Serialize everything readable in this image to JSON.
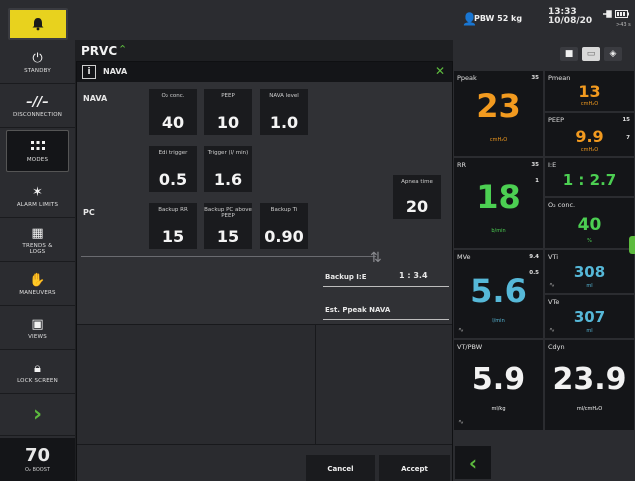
{
  "topbar": {
    "pbw": "PBW 52 kg",
    "time": "13:33",
    "date": "10/08/20",
    "battery_sub": ">43 s",
    "icons": [
      "bell-icon",
      "person-icon",
      "plug-icon",
      "battery-icon"
    ]
  },
  "sidebar": {
    "items": [
      {
        "label": "STANDBY",
        "icon": "power-icon"
      },
      {
        "label": "DISCONNECTION",
        "icon": "disconnect-icon"
      },
      {
        "label": "MODES",
        "icon": "grid-icon"
      },
      {
        "label": "ALARM LIMITS",
        "icon": "alarm-limits-icon"
      },
      {
        "label": "TRENDS & LOGS",
        "icon": "trends-icon"
      },
      {
        "label": "MANEUVERS",
        "icon": "maneuvers-icon"
      },
      {
        "label": "VIEWS",
        "icon": "views-icon"
      },
      {
        "label": "LOCK SCREEN",
        "icon": "lock-icon"
      }
    ],
    "o2_boost_value": "70",
    "o2_boost_label": "O₂ BOOST"
  },
  "mode": {
    "title": "PRVC"
  },
  "dialog": {
    "title": "NAVA",
    "nava_section": "NAVA",
    "pc_section": "PC",
    "params": {
      "o2": {
        "label": "O₂ conc.",
        "value": "40"
      },
      "peep": {
        "label": "PEEP",
        "value": "10"
      },
      "nava_level": {
        "label": "NAVA level",
        "value": "1.0"
      },
      "edi_trigger": {
        "label": "Edi trigger",
        "value": "0.5"
      },
      "trigger": {
        "label": "Trigger (l/ min)",
        "value": "1.6"
      },
      "apnea_time": {
        "label": "Apnea time",
        "value": "20"
      },
      "backup_rr": {
        "label": "Backup RR",
        "value": "15"
      },
      "backup_pc": {
        "label": "Backup PC above PEEP",
        "value": "15"
      },
      "backup_ti": {
        "label": "Backup Ti",
        "value": "0.90"
      }
    },
    "backup_ie_label": "Backup I:E",
    "backup_ie_value": "1 : 3.4",
    "est_ppeak_label": "Est. Ppeak NAVA",
    "cancel_label": "Cancel",
    "accept_label": "Accept"
  },
  "monitor": {
    "view_icons": [
      {
        "name": "camera-icon",
        "badge": "30s"
      },
      {
        "name": "screen-icon",
        "badge": ""
      },
      {
        "name": "layers-icon",
        "badge": ""
      }
    ],
    "ppeak": {
      "label": "Ppeak",
      "value": "23",
      "unit": "cmH₂O",
      "hi": "35"
    },
    "pmean": {
      "label": "Pmean",
      "value": "13",
      "unit": "cmH₂O"
    },
    "peep": {
      "label": "PEEP",
      "value": "9.9",
      "unit": "cmH₂O",
      "hi": "15",
      "lo": "7"
    },
    "rr": {
      "label": "RR",
      "value": "18",
      "unit": "b/min",
      "hi": "35",
      "lo": "1"
    },
    "ie": {
      "label": "I:E",
      "value": "1 : 2.7"
    },
    "o2": {
      "label": "O₂ conc.",
      "value": "40",
      "unit": "%"
    },
    "mve": {
      "label": "MVe",
      "value": "5.6",
      "unit": "l/min",
      "hi": "9.4",
      "lo": "0.5"
    },
    "vti": {
      "label": "VTi",
      "value": "308",
      "unit": "ml"
    },
    "vte": {
      "label": "VTe",
      "value": "307",
      "unit": "ml"
    },
    "vtpbw": {
      "label": "VT/PBW",
      "value": "5.9",
      "unit": "ml/kg"
    },
    "cdyn": {
      "label": "Cdyn",
      "value": "23.9",
      "unit": "ml/cmH₂O"
    }
  },
  "colors": {
    "accent": "#5dbb3e",
    "pressure": "#f29a1f",
    "flow": "#4ccf52",
    "volume": "#56b8d8",
    "alarm": "#e8d21e"
  }
}
